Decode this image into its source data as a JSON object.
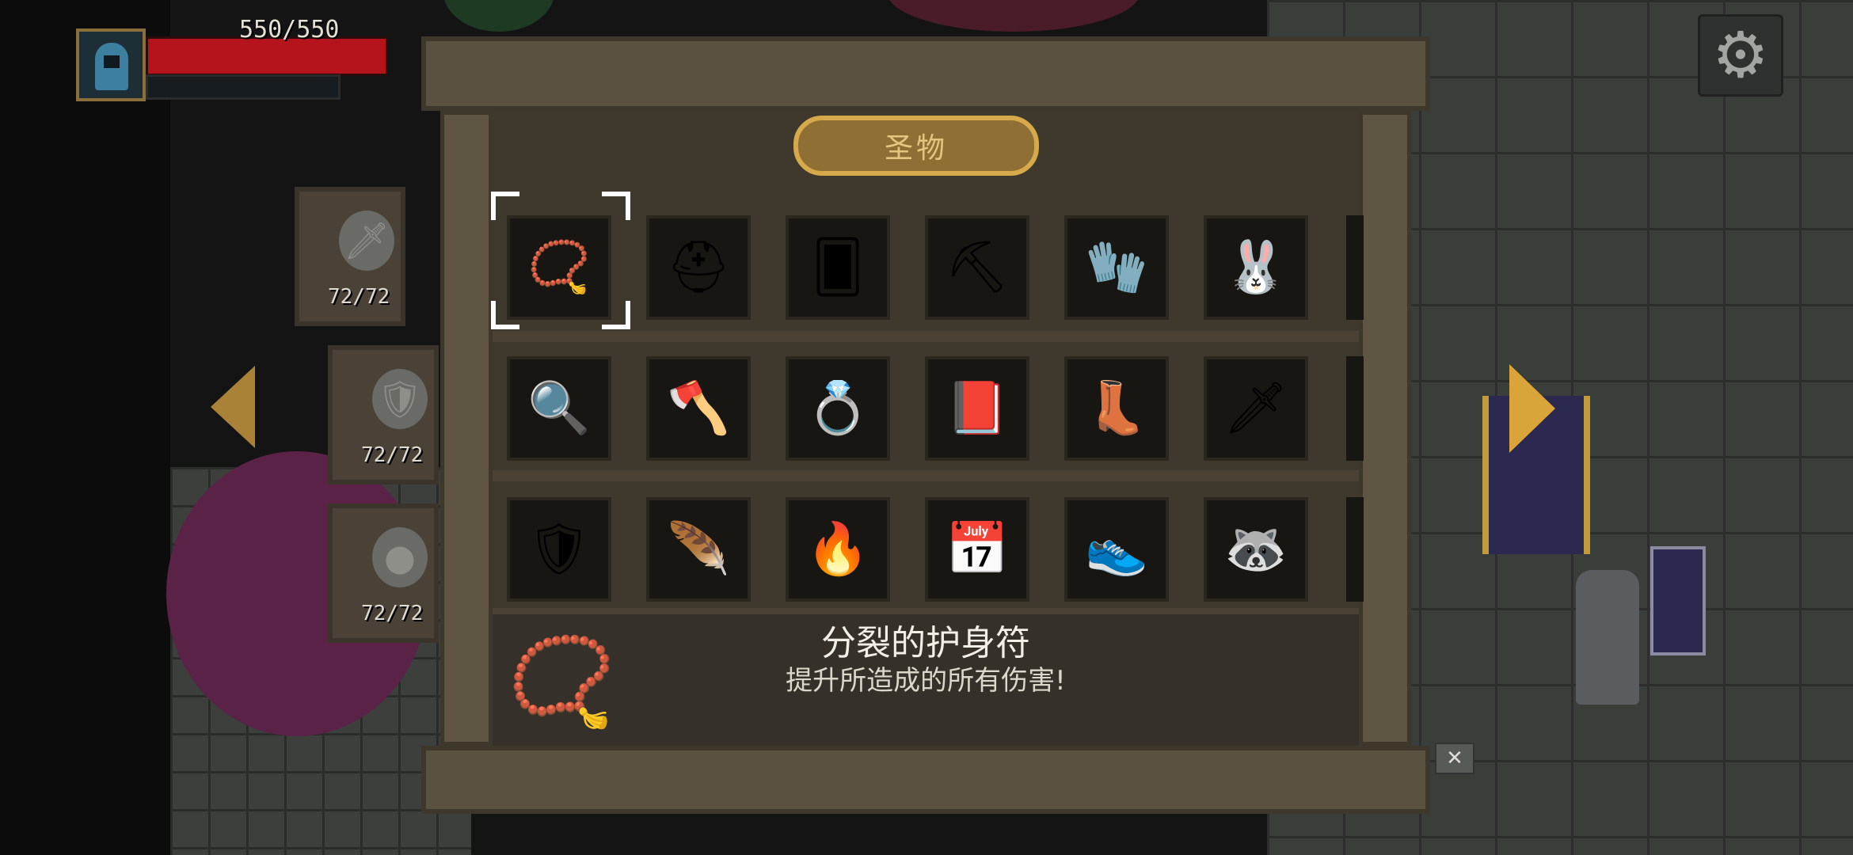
{
  "hud": {
    "hp_text": "550/550",
    "hp_fraction": 1.0
  },
  "weapon_tabs": [
    {
      "icon": "sword-icon",
      "count": "72/72"
    },
    {
      "icon": "shield-icon",
      "count": "72/72"
    },
    {
      "icon": "orb-icon",
      "count": "72/72"
    }
  ],
  "cabinet": {
    "title": "圣物",
    "selected_index": 0,
    "items": [
      {
        "icon": "gold-amulet-icon",
        "glyph": "📿"
      },
      {
        "icon": "viking-helmet-icon",
        "glyph": "⛑"
      },
      {
        "icon": "cards-icon",
        "glyph": "🂠"
      },
      {
        "icon": "shovel-icon",
        "glyph": "⛏"
      },
      {
        "icon": "dark-gauntlet-icon",
        "glyph": "🧤"
      },
      {
        "icon": "bunny-ears-icon",
        "glyph": "🐰"
      },
      {
        "icon": "magic-mirror-icon",
        "glyph": "🔍"
      },
      {
        "icon": "battle-axe-icon",
        "glyph": "🪓"
      },
      {
        "icon": "ring-icon",
        "glyph": "💍"
      },
      {
        "icon": "spellbook-icon",
        "glyph": "📕"
      },
      {
        "icon": "purple-boot-icon",
        "glyph": "👢"
      },
      {
        "icon": "dagger-icon",
        "glyph": "🗡"
      },
      {
        "icon": "gold-armor-icon",
        "glyph": "🛡"
      },
      {
        "icon": "feather-icon",
        "glyph": "🪶"
      },
      {
        "icon": "flaming-sword-icon",
        "glyph": "🔥"
      },
      {
        "icon": "calendar-01-icon",
        "glyph": "📅"
      },
      {
        "icon": "red-sneaker-icon",
        "glyph": "👟"
      },
      {
        "icon": "raccoon-icon",
        "glyph": "🦝"
      }
    ],
    "selected_item": {
      "name": "分裂的护身符",
      "description": "提升所造成的所有伤害!",
      "glyph": "📿"
    }
  },
  "colors": {
    "hp_red": "#b5141c",
    "gold_accent": "#d6a94a",
    "wood": "#5a5240"
  }
}
